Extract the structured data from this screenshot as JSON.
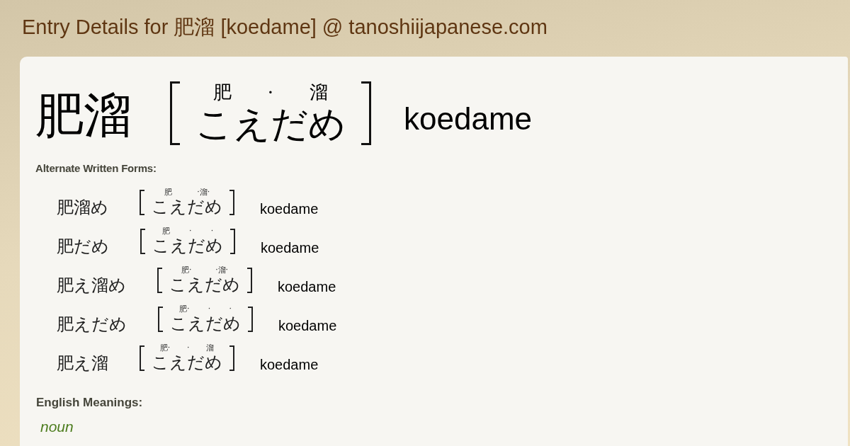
{
  "page_title": "Entry Details for 肥溜 [koedame] @ tanoshiijapanese.com",
  "entry": {
    "word": "肥溜",
    "furigana": [
      "肥",
      "·",
      "溜"
    ],
    "reading": "こえだめ",
    "romaji": "koedame"
  },
  "alternate_forms": {
    "heading": "Alternate Written Forms:",
    "items": [
      {
        "word": "肥溜め",
        "furigana": [
          "肥",
          "·溜·"
        ],
        "reading": "こえだめ",
        "romaji": "koedame"
      },
      {
        "word": "肥だめ",
        "furigana": [
          "肥",
          "·",
          "·"
        ],
        "reading": "こえだめ",
        "romaji": "koedame"
      },
      {
        "word": "肥え溜め",
        "furigana": [
          "肥·",
          "·溜·"
        ],
        "reading": "こえだめ",
        "romaji": "koedame"
      },
      {
        "word": "肥えだめ",
        "furigana": [
          "肥·",
          "·",
          "·"
        ],
        "reading": "こえだめ",
        "romaji": "koedame"
      },
      {
        "word": "肥え溜",
        "furigana": [
          "肥·",
          "·",
          "溜"
        ],
        "reading": "こえだめ",
        "romaji": "koedame"
      }
    ]
  },
  "english_meanings": {
    "heading": "English Meanings:",
    "part_of_speech": "noun"
  }
}
